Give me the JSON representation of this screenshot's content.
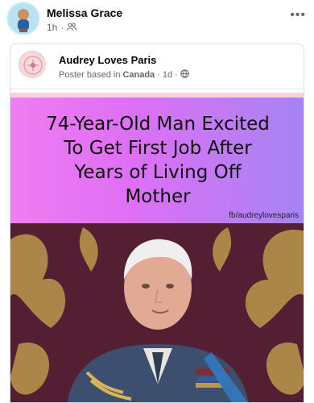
{
  "post": {
    "author": "Melissa Grace",
    "time": "1h",
    "audience_icon": "friends-icon",
    "more_icon": "more-options-icon"
  },
  "shared": {
    "page_name": "Audrey Loves Paris",
    "meta_prefix": "Poster based in",
    "location": "Canada",
    "separator": "·",
    "time": "1d",
    "audience_icon": "globe-icon"
  },
  "image": {
    "headline_lines": [
      "74-Year-Old Man Excited",
      "To Get First Job After",
      "Years of Living Off",
      "Mother"
    ],
    "credit": "fb/audreylovesparis"
  },
  "colors": {
    "headline_gradient_start": "#f07df2",
    "headline_gradient_end": "#a584f4",
    "frame_pink": "#f9d0dd",
    "photo_background": "#541e33",
    "damask_gold": "#b99a4c"
  }
}
